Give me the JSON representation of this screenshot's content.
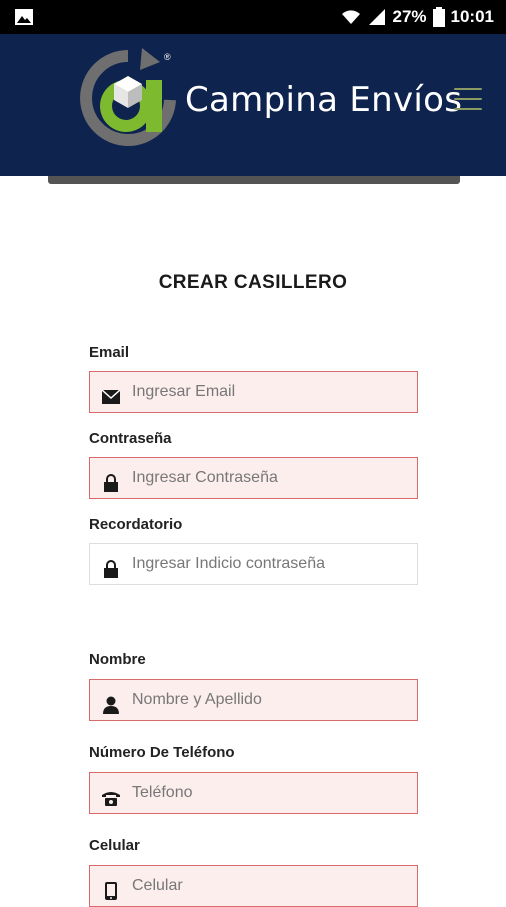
{
  "status_bar": {
    "battery": "27%",
    "time": "10:01"
  },
  "header": {
    "brand": "Campina Envíos",
    "logo_mark": "®"
  },
  "form": {
    "title": "CREAR CASILLERO",
    "fields": [
      {
        "label": "Email",
        "placeholder": "Ingresar Email",
        "icon": "envelope-icon"
      },
      {
        "label": "Contraseña",
        "placeholder": "Ingresar Contraseña",
        "icon": "lock-icon"
      },
      {
        "label": "Recordatorio",
        "placeholder": "Ingresar Indicio contraseña",
        "icon": "lock-icon"
      },
      {
        "label": "Nombre",
        "placeholder": "Nombre y Apellido",
        "icon": "user-icon"
      },
      {
        "label": "Número De Teléfono",
        "placeholder": "Teléfono",
        "icon": "phone-icon"
      },
      {
        "label": "Celular",
        "placeholder": "Celular",
        "icon": "mobile-icon"
      }
    ]
  },
  "colors": {
    "header_bg": "#0e234d",
    "logo_green": "#7dba2f",
    "logo_gray": "#6f6f6f",
    "invalid_border": "#d86a6a",
    "invalid_bg": "#fdeeee"
  }
}
